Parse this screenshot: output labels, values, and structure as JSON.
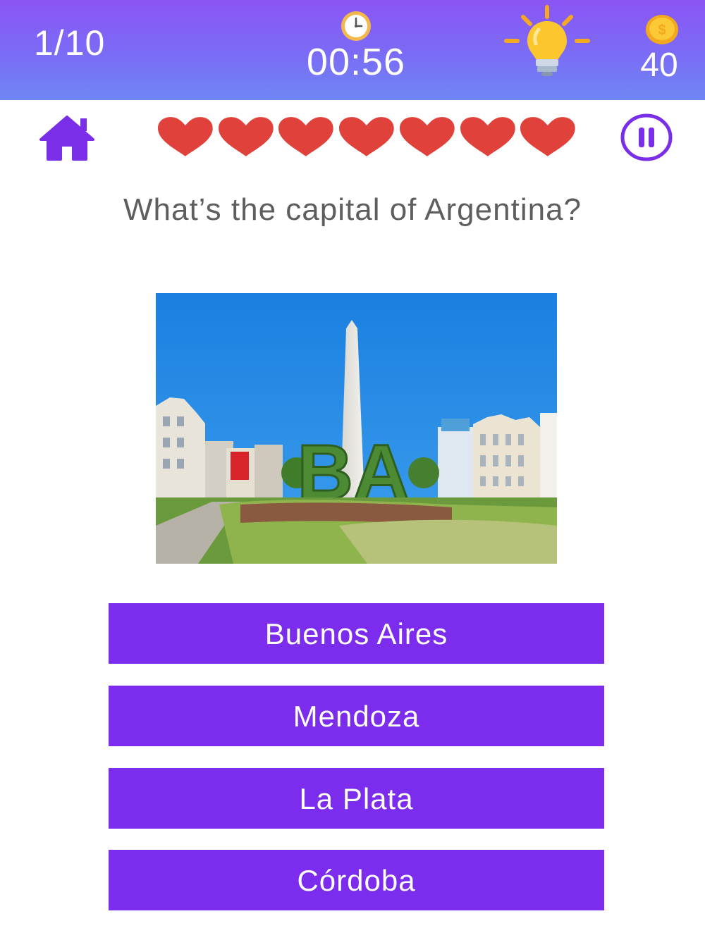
{
  "header": {
    "progress": "1/10",
    "timer": "00:56",
    "coins": "40",
    "clock_icon": "clock-icon",
    "hint_icon": "lightbulb-icon",
    "coin_icon": "coin-icon"
  },
  "controls": {
    "home_icon": "home-icon",
    "pause_icon": "pause-icon",
    "lives": 7,
    "heart_icon": "heart-icon"
  },
  "question": {
    "text": "What’s the capital of Argentina?",
    "image_letters": "BA"
  },
  "answers": [
    {
      "label": "Buenos Aires"
    },
    {
      "label": "Mendoza"
    },
    {
      "label": "La Plata"
    },
    {
      "label": "Córdoba"
    }
  ],
  "colors": {
    "header_gradient_top": "#8b55f5",
    "header_gradient_bottom": "#6f86f3",
    "answer_button": "#7c2cec",
    "heart": "#e0413a",
    "accent_purple": "#7a2ee8",
    "question_text": "#5e5e5e"
  }
}
